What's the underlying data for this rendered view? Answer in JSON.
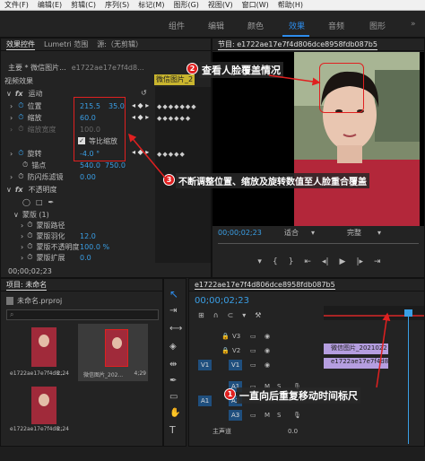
{
  "menu": [
    "文件(F)",
    "编辑(E)",
    "剪辑(C)",
    "序列(S)",
    "标记(M)",
    "图形(G)",
    "视图(V)",
    "窗口(W)",
    "帮助(H)"
  ],
  "workspace_tabs": [
    {
      "label": "组件",
      "active": false
    },
    {
      "label": "编辑",
      "active": false
    },
    {
      "label": "颜色",
      "active": false
    },
    {
      "label": "效果",
      "active": true
    },
    {
      "label": "音频",
      "active": false
    },
    {
      "label": "图形",
      "active": false
    }
  ],
  "effect_controls": {
    "tabs": [
      "效果控件",
      "Lumetri 范围",
      "源:（无剪辑）"
    ],
    "master": "主要 * 微信图片...",
    "seq": "e1722ae17e7f4d8...",
    "clip_label": "微信图片_2",
    "video_effects": "视频效果",
    "motion": "运动",
    "position_label": "位置",
    "position_x": "215.5",
    "position_y": "35.0",
    "scale_label": "缩放",
    "scale_value": "60.0",
    "scale_width_label": "缩放宽度",
    "scale_width_value": "100.0",
    "uniform_label": "等比缩放",
    "rotation_label": "旋转",
    "rotation_value": "-4.0 °",
    "anchor_label": "锚点",
    "anchor_x": "540.0",
    "anchor_y": "750.0",
    "flicker_label": "防闪烁滤镜",
    "flicker_value": "0.00",
    "opacity_label": "不透明度",
    "mask_label": "蒙版 (1)",
    "mask_path_label": "蒙版路径",
    "mask_feather_label": "蒙版羽化",
    "mask_feather_value": "12.0",
    "mask_opacity_label": "蒙版不透明度",
    "mask_opacity_value": "100.0 %",
    "mask_expansion_label": "蒙版扩展",
    "mask_expansion_value": "0.0",
    "timecode": "00;00;02;23"
  },
  "program": {
    "title": "节目: e1722ae17e7f4d806dce8958fdb087b5",
    "timecode": "00;00;02;23",
    "fit": "适合",
    "quality": "完整"
  },
  "project": {
    "title": "项目: 未命名",
    "file": "未命名.prproj",
    "items": [
      {
        "name": "e1722ae17e7f4d8...",
        "duration": "2;24"
      },
      {
        "name": "微信图片_202...",
        "duration": "4;29"
      },
      {
        "name": "e1722ae17e7f4d8...",
        "duration": "2;24"
      }
    ]
  },
  "timeline": {
    "title": "e1722ae17e7f4d806dce8958fdb087b5",
    "timecode": "00;00;02;23",
    "tracks": [
      "V3",
      "V2",
      "V1",
      "A1",
      "A2",
      "A3"
    ],
    "source_v": "V1",
    "source_a": "A1",
    "master_label": "主声道",
    "master_value": "0.0",
    "clip_v2": "微信图片_2021022",
    "clip_v1": "e1722ae17e7f4d806dce8958fdb087b5"
  },
  "annotations": {
    "a1_num": "1",
    "a1_text": "一直向后重复移动时间标尺",
    "a2_num": "2",
    "a2_text": "查看人脸覆盖情况",
    "a3_num": "3",
    "a3_text": "不断调整位置、缩放及旋转数值至人脸重合覆盖"
  },
  "colors": {
    "accent": "#2d8ceb",
    "annotation": "#e02020",
    "clip_purple": "#b59ee0"
  },
  "playhead_ratio": 0.42
}
